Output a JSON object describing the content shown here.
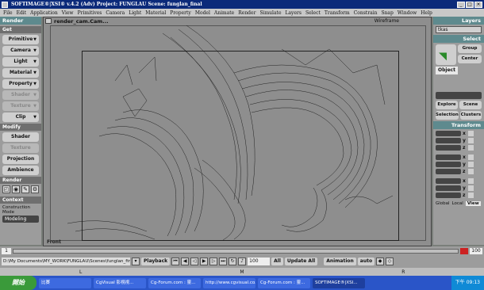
{
  "window": {
    "title": "SOFTIMAGE®|XSI® v.4.2 (Adv) Project: FUNGLAU   Scene: funglan_final"
  },
  "menubar": [
    "File",
    "Edit",
    "Application",
    "View",
    "Primitives",
    "Camera",
    "Light",
    "Material",
    "Property",
    "Model",
    "Animate",
    "Render",
    "Simulate",
    "Layers",
    "Select",
    "Transform",
    "Constrain",
    "Snap",
    "Window",
    "Help"
  ],
  "left_panel": {
    "header": "Render",
    "get_label": "Get",
    "get_buttons": [
      "Primitive",
      "Camera",
      "Light",
      "Material",
      "Property",
      "Shader",
      "Texture",
      "Clip"
    ],
    "modify_label": "Modify",
    "modify_buttons": [
      "Shader",
      "Texture",
      "Projection",
      "Ambience"
    ],
    "render_label": "Render",
    "context_label": "Context",
    "construction_mode_label": "Construction Mode",
    "construction_mode_value": "Modeling"
  },
  "viewport": {
    "camera_label": "render_cam.Cam...",
    "shading_mode": "Wireframe",
    "axis_label": "Front"
  },
  "right_panel": {
    "layers_label": "Layers",
    "layer_field": "tkas",
    "select_label": "Select",
    "group_label": "Group",
    "center_label": "Center",
    "object_tab": "Object",
    "explore_label": "Explore",
    "scene_label": "Scene",
    "selection_label": "Selection",
    "clusters_label": "Clusters",
    "transform_label": "Transform",
    "axes": [
      "x",
      "y",
      "z",
      "x",
      "y",
      "z",
      "x",
      "y",
      "z"
    ],
    "coord_tabs": [
      "Global",
      "Local",
      "View"
    ]
  },
  "timeline": {
    "start": "1",
    "end": "100"
  },
  "playback": {
    "path": "D:\\My Documents\\MY_WORK\\FUNGLAU\\Scenes\\funglan_final.scn",
    "playback_label": "Playback",
    "frame_value": "100",
    "all_label": "All",
    "update_all_label": "Update All",
    "animation_label": "Animation",
    "auto_label": "auto"
  },
  "statusline": [
    "L",
    "M",
    "R"
  ],
  "taskbar": {
    "start_label": "開始",
    "tasks": [
      "比賽",
      "CgVisual 影視視... ",
      "Cg-Forum.com : 靈...",
      "http://www.cgvisual.co...",
      "Cg-Forum.com : 靈...",
      "SOFTIMAGE®|XSI..."
    ],
    "clock": "下午 09:13"
  }
}
